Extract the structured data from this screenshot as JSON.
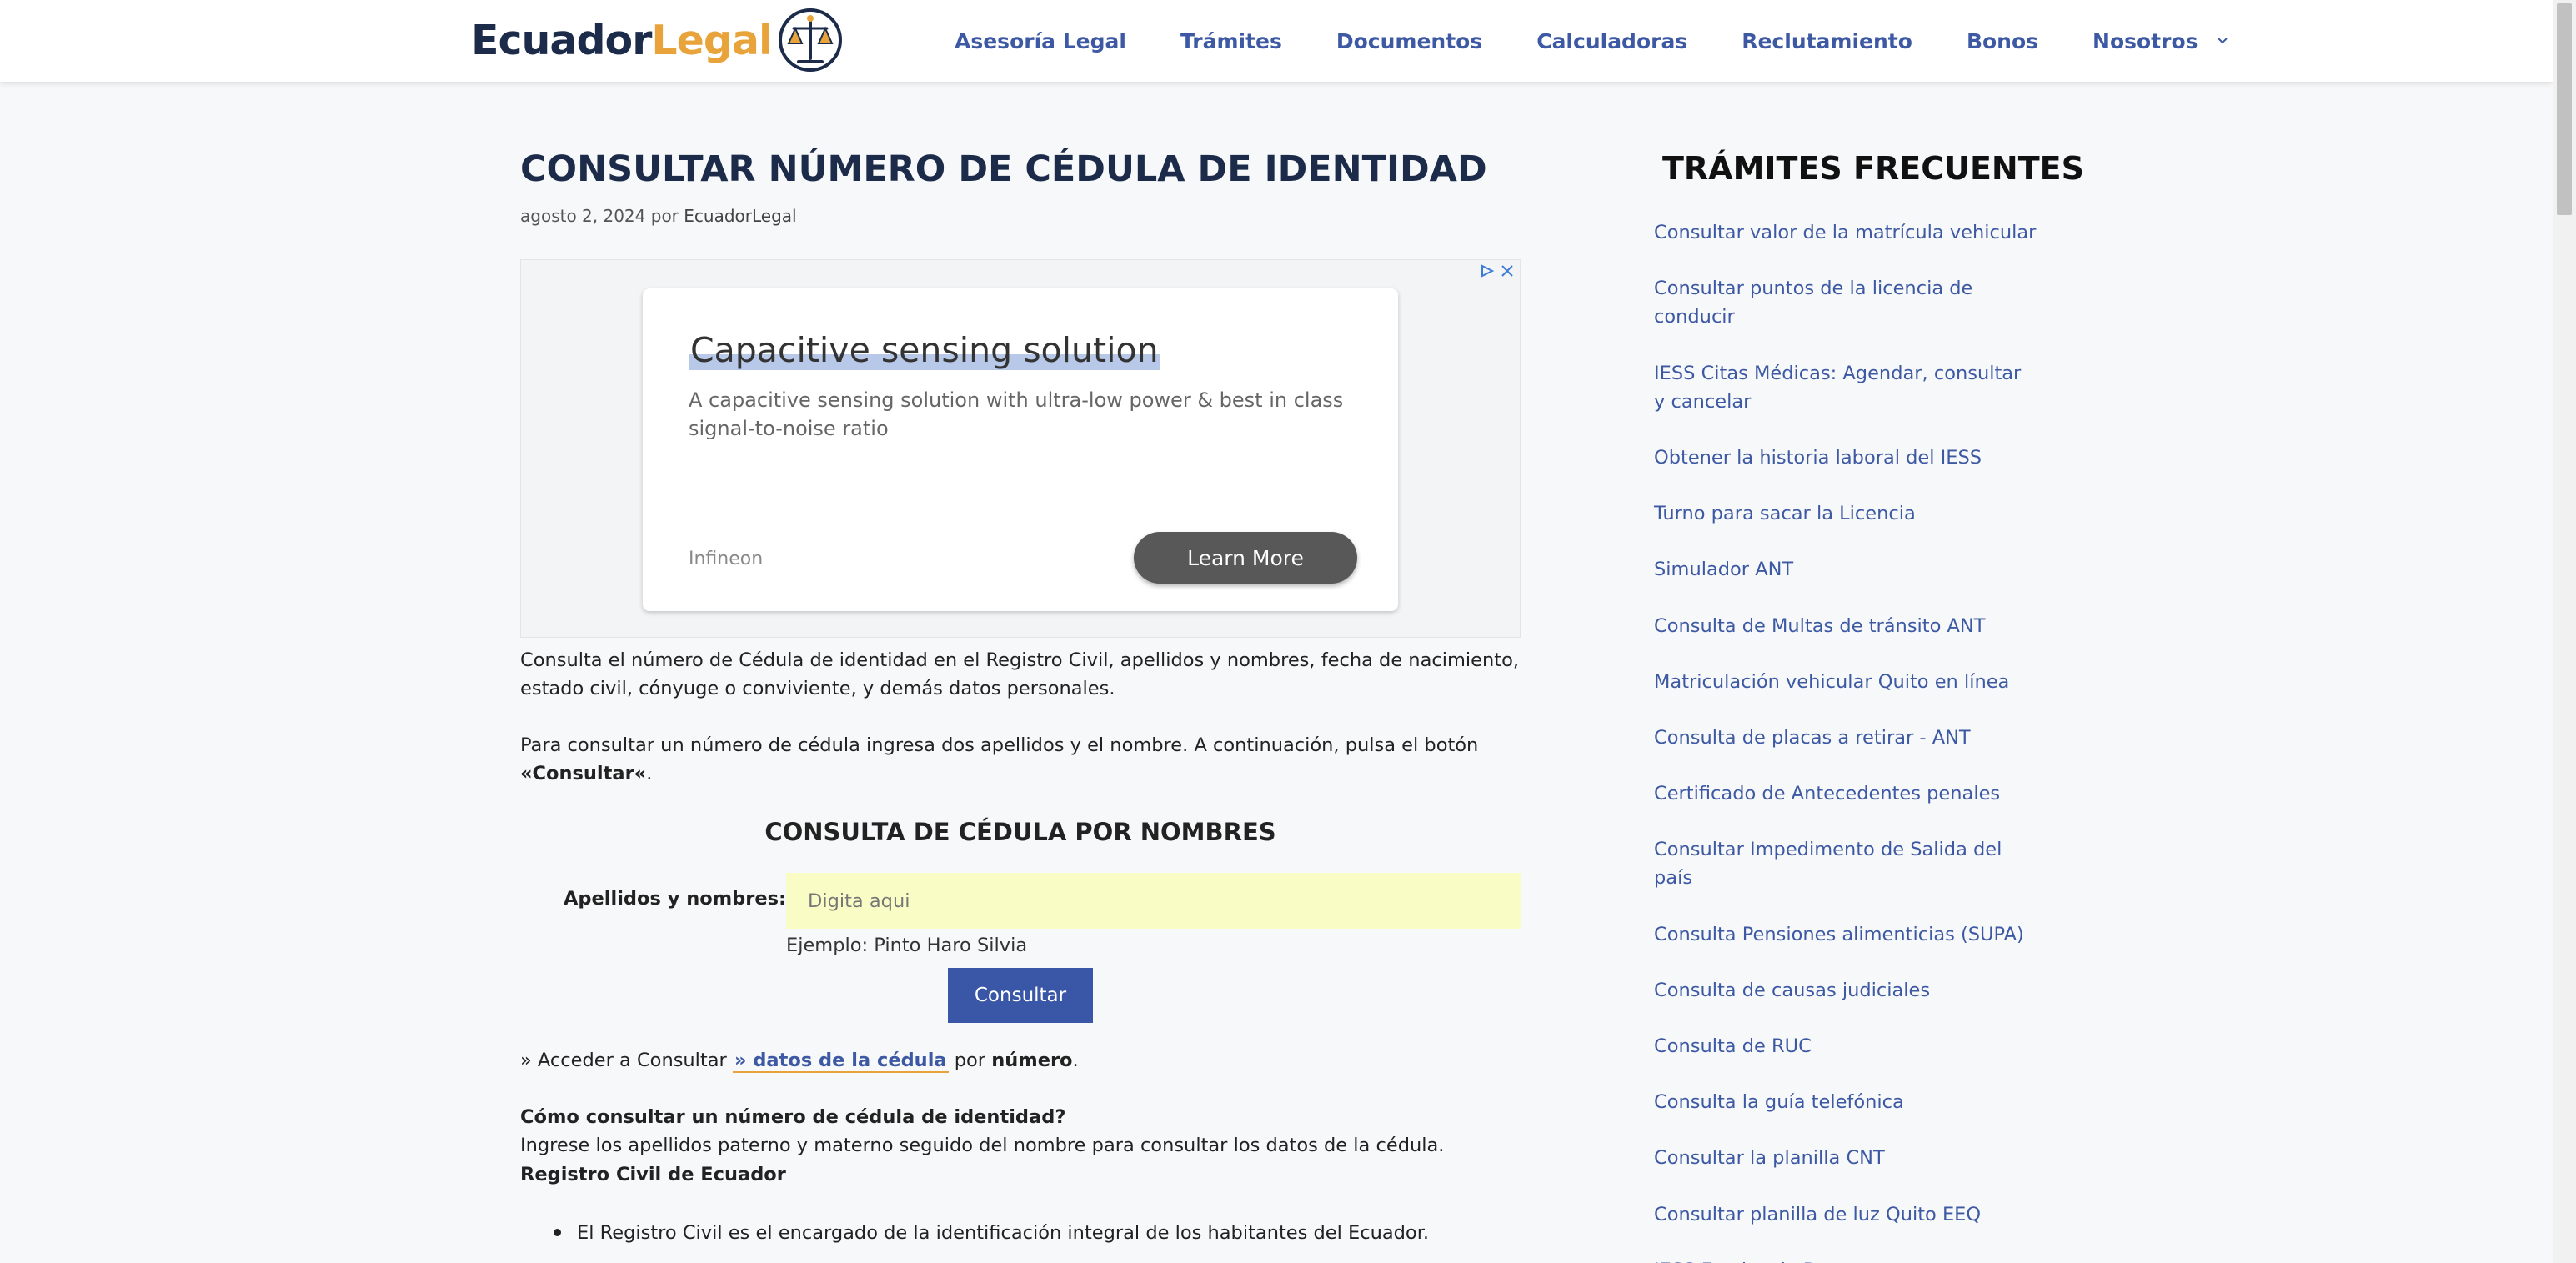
{
  "header": {
    "logo_part1": "Ecuador",
    "logo_part2": "Legal",
    "nav": [
      {
        "label": "Asesoría Legal"
      },
      {
        "label": "Trámites"
      },
      {
        "label": "Documentos"
      },
      {
        "label": "Calculadoras"
      },
      {
        "label": "Reclutamiento"
      },
      {
        "label": "Bonos"
      },
      {
        "label": "Nosotros"
      }
    ]
  },
  "article": {
    "title": "CONSULTAR NÚMERO DE CÉDULA DE IDENTIDAD",
    "date": "agosto 2, 2024",
    "by": "por",
    "author": "EcuadorLegal",
    "ad": {
      "headline": "Capacitive sensing solution",
      "description": "A capacitive sensing solution with ultra-low power & best in class signal-to-noise ratio",
      "brand": "Infineon",
      "cta": "Learn More",
      "choices_icon": "adchoices-icon",
      "close_icon": "close-icon"
    },
    "intro": "Consulta el número de Cédula de identidad en el Registro Civil, apellidos y nombres, fecha de nacimiento, estado civil, cónyuge o conviviente, y demás datos personales.",
    "instruction_pre": "Para consultar un número de cédula ingresa dos apellidos y el nombre. A continuación, pulsa el botón ",
    "instruction_bold": "«Consultar«",
    "instruction_post": ".",
    "form": {
      "title": "CONSULTA DE CÉDULA POR NOMBRES",
      "label": "Apellidos y nombres:",
      "placeholder": "Digita aqui",
      "value": "",
      "example": "Ejemplo: Pinto Haro Silvia",
      "button": "Consultar"
    },
    "link_pre": "» Acceder a Consultar ",
    "link_text": "» datos de la cédula",
    "link_mid": " por ",
    "link_bold": "número",
    "link_post": ".",
    "faq_question": "Cómo consultar un número de cédula de identidad?",
    "faq_answer": "Ingrese los apellidos paterno y materno seguido del nombre para consultar los datos de la cédula.",
    "section_heading": "Registro Civil de Ecuador",
    "bullets": [
      "El Registro Civil es el encargado de la identificación integral de los habitantes del Ecuador."
    ]
  },
  "sidebar": {
    "title": "TRÁMITES FRECUENTES",
    "links": [
      "Consultar valor de la matrícula vehicular",
      "Consultar puntos de la licencia de conducir",
      "IESS Citas Médicas: Agendar, consultar y cancelar",
      "Obtener la historia laboral del IESS",
      "Turno para sacar la Licencia",
      "Simulador ANT",
      "Consulta de Multas de tránsito ANT",
      "Matriculación vehicular Quito en línea",
      "Consulta de placas a retirar - ANT",
      "Certificado de Antecedentes penales",
      "Consultar Impedimento de Salida del país",
      "Consulta Pensiones alimenticias (SUPA)",
      "Consulta de causas judiciales",
      "Consulta de RUC",
      "Consulta la guía telefónica",
      "Consultar la planilla CNT",
      "Consultar planilla de luz Quito EEQ",
      "IESS Fondos de Reserva"
    ]
  },
  "colors": {
    "brand_dark": "#1c2b4a",
    "brand_gold": "#e8a43a",
    "link_blue": "#3d59a4",
    "button_blue": "#3a57a7",
    "input_bg": "#fafcc6"
  }
}
